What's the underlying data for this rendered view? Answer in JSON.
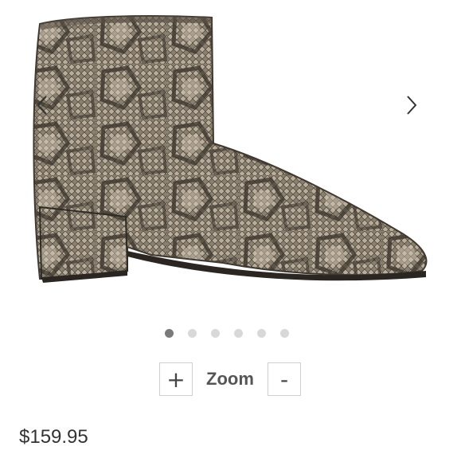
{
  "gallery": {
    "prev_icon": "chevron-left-icon",
    "next_icon": "chevron-right-icon",
    "dot_count": 6,
    "active_dot": 1,
    "image_subject": "snakeskin ankle boot"
  },
  "zoom": {
    "plus_label": "+",
    "label": "Zoom",
    "minus_label": "-"
  },
  "product": {
    "price": "$159.95"
  },
  "colors": {
    "active_dot": "#7a7a7a",
    "inactive_dot": "#d8d8d8",
    "border": "#cfcfcf"
  }
}
